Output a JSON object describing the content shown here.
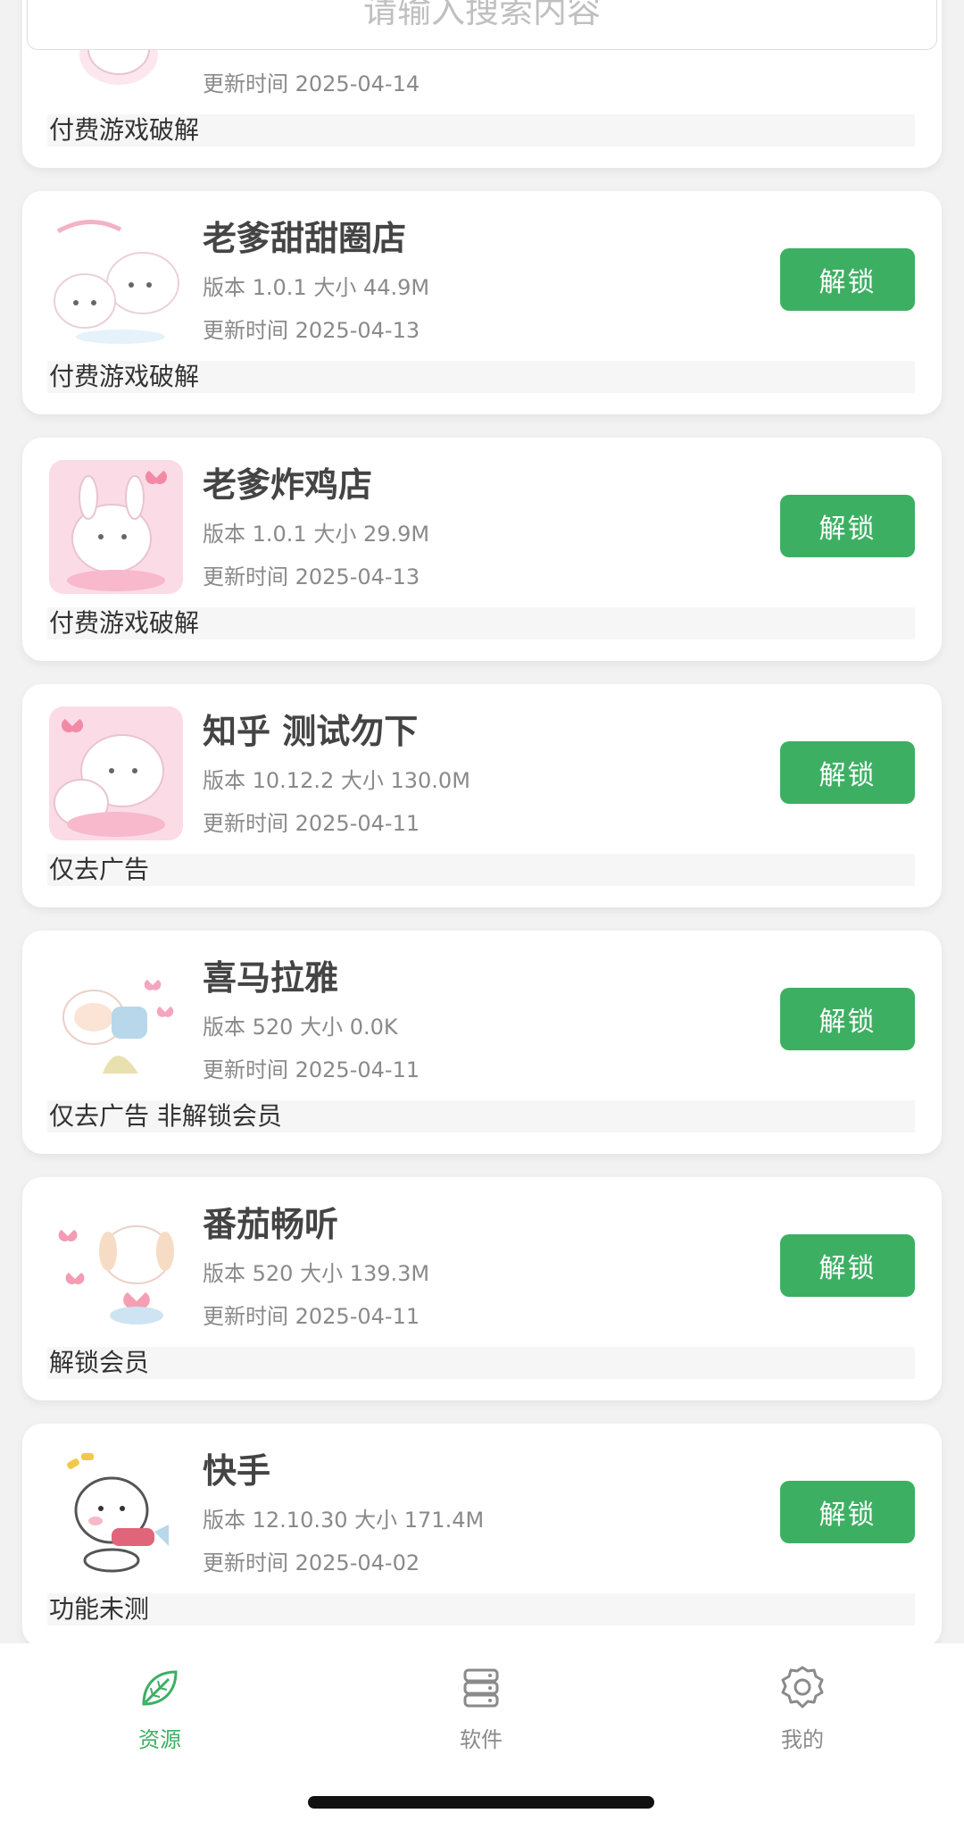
{
  "search": {
    "placeholder": "请输入搜索内容"
  },
  "items": [
    {
      "title": "",
      "meta": "",
      "updated": "更新时间 2025-04-14",
      "tag": "付费游戏破解",
      "button": "",
      "thumb_colors": [
        "#fde7ee",
        "#ffffff",
        "#f5b7c6"
      ]
    },
    {
      "title": "老爹甜甜圈店",
      "meta": "版本 1.0.1 大小 44.9M",
      "updated": "更新时间 2025-04-13",
      "tag": "付费游戏破解",
      "button": "解锁",
      "thumb_colors": [
        "#fde7ee",
        "#ffffff",
        "#f5b7c6"
      ]
    },
    {
      "title": "老爹炸鸡店",
      "meta": "版本 1.0.1 大小 29.9M",
      "updated": "更新时间 2025-04-13",
      "tag": "付费游戏破解",
      "button": "解锁",
      "thumb_colors": [
        "#fbd9e4",
        "#ffffff",
        "#f29ab3"
      ]
    },
    {
      "title": "知乎 测试勿下",
      "meta": "版本 10.12.2 大小 130.0M",
      "updated": "更新时间 2025-04-11",
      "tag": "仅去广告",
      "button": "解锁",
      "thumb_colors": [
        "#fbd9e4",
        "#ffffff",
        "#f29ab3"
      ]
    },
    {
      "title": "喜马拉雅",
      "meta": "版本 520 大小 0.0K",
      "updated": "更新时间 2025-04-11",
      "tag": "仅去广告 非解锁会员",
      "button": "解锁",
      "thumb_colors": [
        "#ffffff",
        "#fbe3d6",
        "#f3a6bd"
      ]
    },
    {
      "title": "番茄畅听",
      "meta": "版本 520 大小 139.3M",
      "updated": "更新时间 2025-04-11",
      "tag": "解锁会员",
      "button": "解锁",
      "thumb_colors": [
        "#ffffff",
        "#fbe7d8",
        "#f39cb3"
      ]
    },
    {
      "title": "快手",
      "meta": "版本 12.10.30 大小 171.4M",
      "updated": "更新时间 2025-04-02",
      "tag": "功能未测",
      "button": "解锁",
      "thumb_colors": [
        "#ffffff",
        "#ffffff",
        "#e0647a"
      ]
    }
  ],
  "tabs": [
    {
      "label": "资源",
      "icon": "leaf-icon",
      "active": true
    },
    {
      "label": "软件",
      "icon": "server-icon",
      "active": false
    },
    {
      "label": "我的",
      "icon": "gear-icon",
      "active": false
    }
  ],
  "colors": {
    "accent": "#3daf63",
    "inactive": "#8a8a8a"
  }
}
